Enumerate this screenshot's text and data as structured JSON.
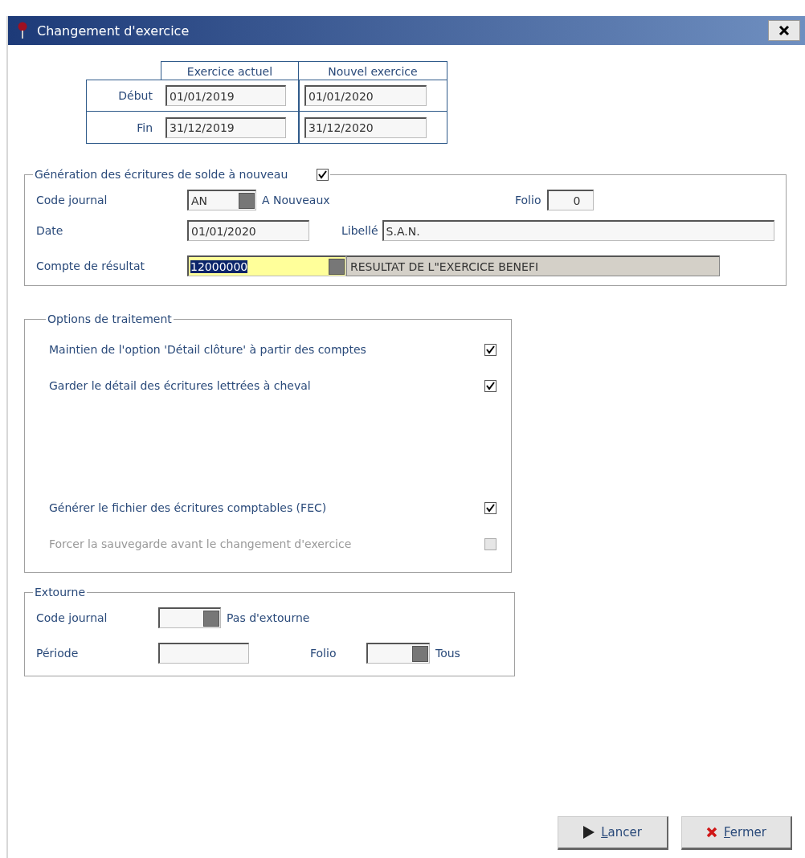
{
  "window": {
    "title": "Changement d'exercice"
  },
  "periods": {
    "columns": [
      "Exercice actuel",
      "Nouvel exercice"
    ],
    "rows": [
      {
        "label": "Début",
        "values": [
          "01/01/2019",
          "01/01/2020"
        ]
      },
      {
        "label": "Fin",
        "values": [
          "31/12/2019",
          "31/12/2020"
        ]
      }
    ]
  },
  "generation": {
    "title": "Génération des écritures de solde à nouveau",
    "checked": true,
    "journal": {
      "label": "Code journal",
      "value": "AN",
      "description": "A Nouveaux"
    },
    "folio": {
      "label": "Folio",
      "value": "0"
    },
    "date": {
      "label": "Date",
      "value": "01/01/2020"
    },
    "libelle": {
      "label": "Libellé",
      "value": "S.A.N."
    },
    "compte": {
      "label": "Compte de résultat",
      "value": "12000000",
      "selected": true,
      "description": "RESULTAT DE L\"EXERCICE BENEFI"
    }
  },
  "options": {
    "title": "Options de traitement",
    "items": [
      {
        "label": "Maintien de l'option 'Détail clôture' à partir des comptes",
        "checked": true,
        "disabled": false
      },
      {
        "label": "Garder le détail des écritures lettrées à cheval",
        "checked": true,
        "disabled": false
      },
      {
        "label": "Générer le fichier des écritures comptables (FEC)",
        "checked": true,
        "disabled": false
      },
      {
        "label": "Forcer la sauvegarde avant le changement d'exercice",
        "checked": false,
        "disabled": true
      }
    ]
  },
  "extourne": {
    "title": "Extourne",
    "journal": {
      "label": "Code journal",
      "description": "Pas d'extourne"
    },
    "periode": {
      "label": "Période"
    },
    "folio": {
      "label": "Folio",
      "description": "Tous"
    }
  },
  "buttons": [
    {
      "label": "Lancer",
      "kind": "run"
    },
    {
      "label": "Fermer",
      "kind": "close"
    }
  ]
}
